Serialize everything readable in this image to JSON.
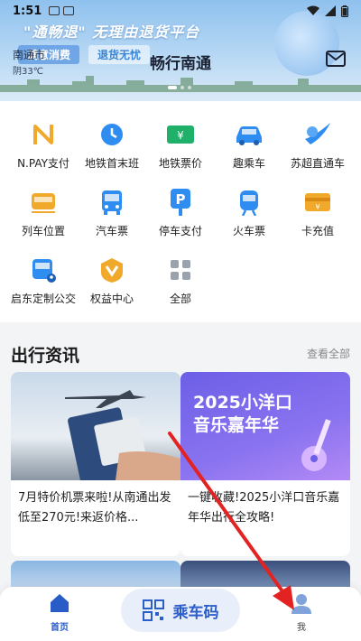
{
  "status_bar": {
    "time": "1:51"
  },
  "header": {
    "city": "南通市",
    "weather": "阴33℃",
    "title": "畅行南通"
  },
  "banner": {
    "slogan": "\"通畅退\"  无理由退货平台",
    "chips": [
      "满意消费",
      "退货无忧"
    ]
  },
  "services": [
    {
      "label": "N.PAY支付",
      "icon": "npay-icon",
      "color": "#f0a92b"
    },
    {
      "label": "地铁首末班",
      "icon": "clock-icon",
      "color": "#2f8cf0"
    },
    {
      "label": "地铁票价",
      "icon": "ticket-icon",
      "color": "#1fb06a"
    },
    {
      "label": "趣乘车",
      "icon": "car-icon",
      "color": "#2f8cf0"
    },
    {
      "label": "苏超直通车",
      "icon": "soccer-icon",
      "color": "#2f8cf0"
    },
    {
      "label": "列车位置",
      "icon": "train-icon",
      "color": "#f0a92b"
    },
    {
      "label": "汽车票",
      "icon": "bus-icon",
      "color": "#2f8cf0"
    },
    {
      "label": "停车支付",
      "icon": "parking-icon",
      "color": "#2f8cf0"
    },
    {
      "label": "火车票",
      "icon": "railway-icon",
      "color": "#2f8cf0"
    },
    {
      "label": "卡充值",
      "icon": "card-icon",
      "color": "#f0a92b"
    },
    {
      "label": "启东定制公交",
      "icon": "custom-bus-icon",
      "color": "#2f8cf0"
    },
    {
      "label": "权益中心",
      "icon": "benefit-icon",
      "color": "#f0a92b"
    },
    {
      "label": "全部",
      "icon": "grid-icon",
      "color": "#9aa3ad"
    }
  ],
  "news": {
    "title": "出行资讯",
    "more": "查看全部",
    "cards": [
      {
        "text": "7月特价机票来啦!从南通出发低至270元!来返价格..."
      },
      {
        "text": "一键收藏!2025小洋口音乐嘉年华出行全攻略!",
        "image_title": "2025小洋口\n音乐嘉年华"
      }
    ]
  },
  "nav": {
    "home": "首页",
    "ride_code": "乘车码",
    "me": "我"
  },
  "colors": {
    "accent": "#2b5ec9",
    "annotation_arrow": "#e32222"
  }
}
